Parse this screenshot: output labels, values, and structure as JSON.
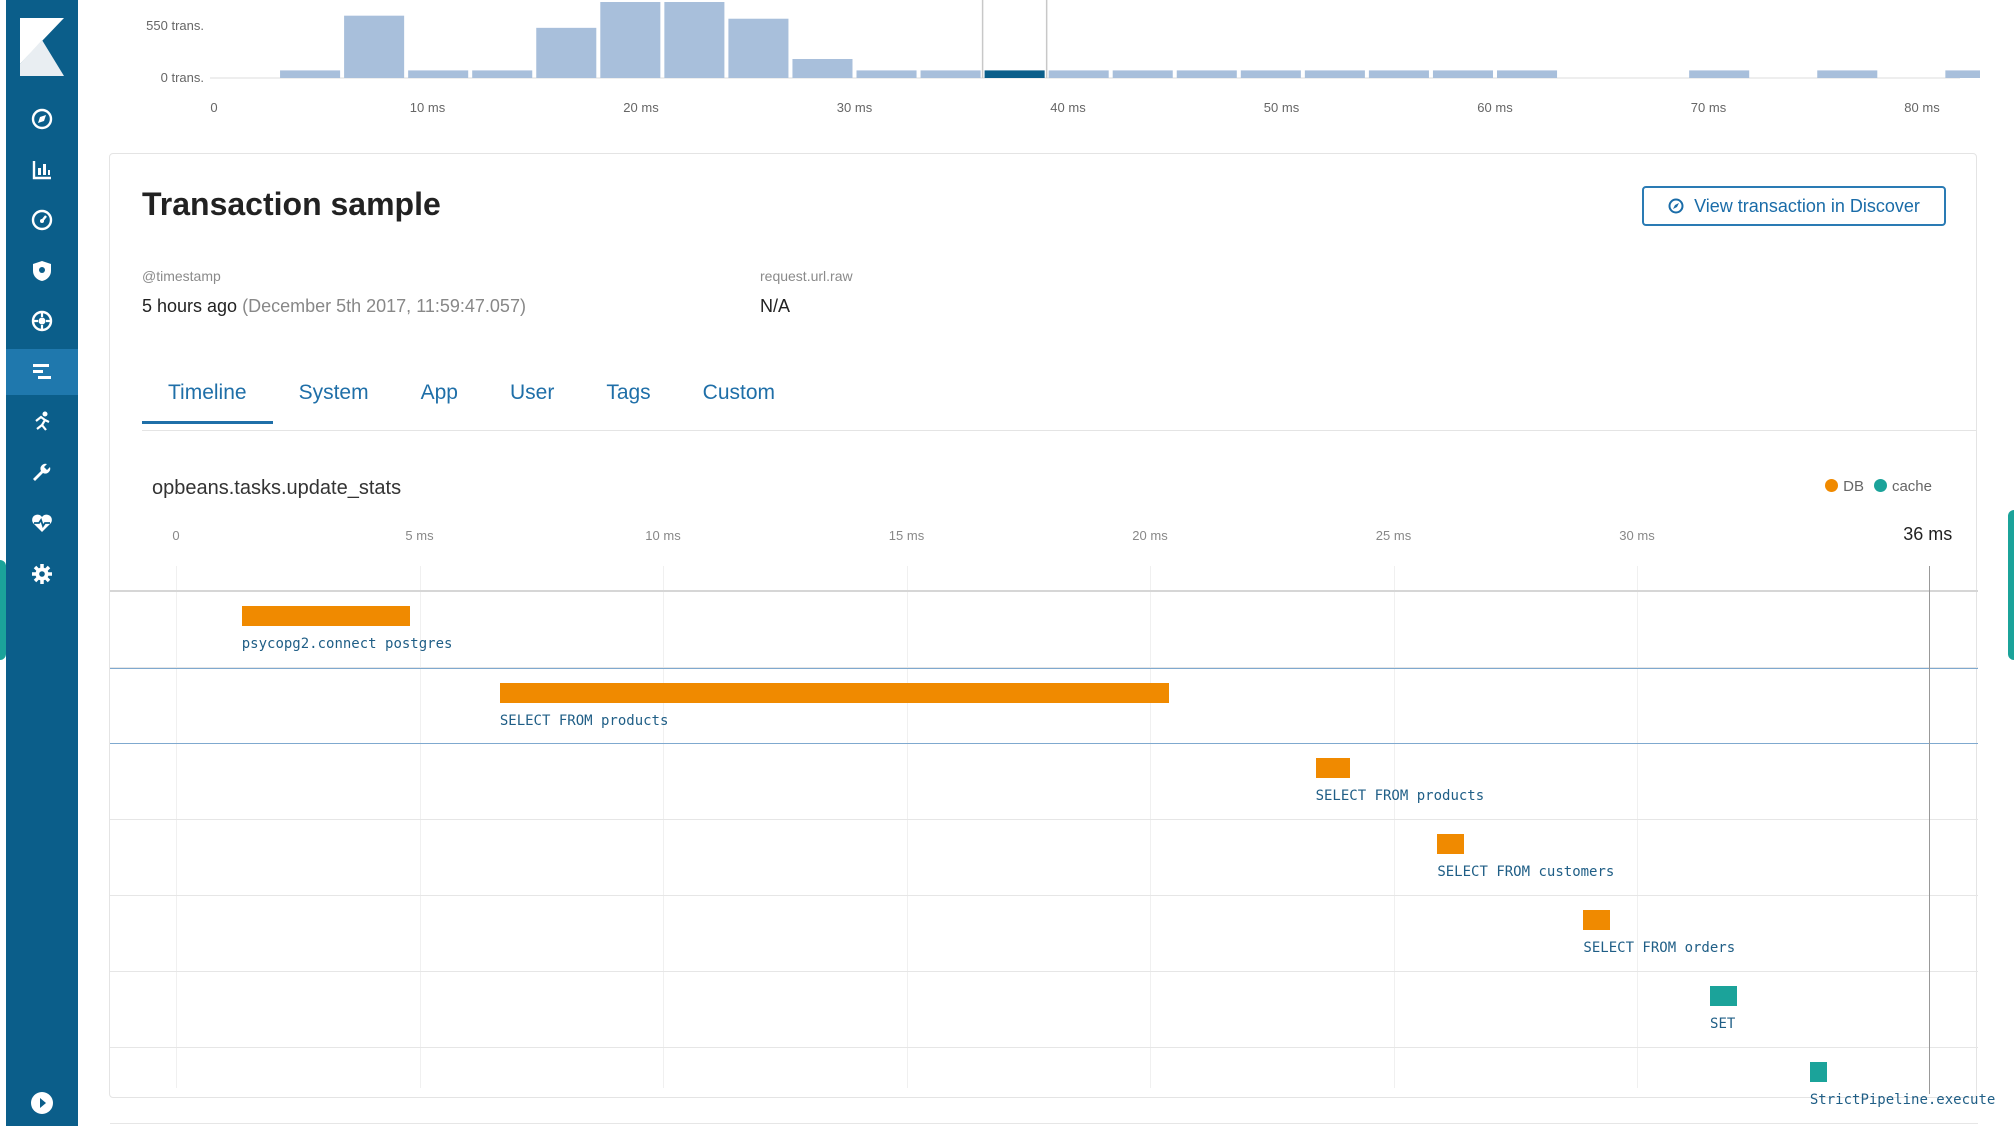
{
  "colors": {
    "sidebar": "#0b5e8a",
    "accent": "#1f6fa8",
    "db": "#f08a00",
    "cache": "#1ba39a",
    "hist_bar": "#a8bfdb",
    "hist_selected": "#0b5e8a"
  },
  "sidebar": {
    "items": [
      {
        "icon": "compass-icon"
      },
      {
        "icon": "bar-chart-icon"
      },
      {
        "icon": "gauge-icon"
      },
      {
        "icon": "shield-icon"
      },
      {
        "icon": "cluster-icon"
      },
      {
        "icon": "apm-icon",
        "active": true
      },
      {
        "icon": "running-icon"
      },
      {
        "icon": "wrench-icon"
      },
      {
        "icon": "heartbeat-icon"
      },
      {
        "icon": "gear-icon"
      }
    ],
    "bottom_icon": "collapse-play-icon"
  },
  "histogram": {
    "y_labels": [
      "550 trans.",
      "0 trans."
    ],
    "x_labels": [
      "0",
      "10 ms",
      "20 ms",
      "30 ms",
      "40 ms",
      "50 ms",
      "60 ms",
      "70 ms",
      "80 ms"
    ],
    "bucket_size_ms": 3,
    "buckets": [
      0,
      10,
      82,
      10,
      10,
      66,
      100,
      100,
      78,
      25,
      10,
      10,
      10,
      10,
      10,
      10,
      10,
      10,
      10,
      10,
      10,
      0,
      0,
      10,
      0,
      10,
      0,
      10
    ],
    "selected_bucket": 12
  },
  "sample": {
    "title": "Transaction sample",
    "discover_button": "View transaction in Discover",
    "timestamp_label": "@timestamp",
    "timestamp_relative": "5 hours ago",
    "timestamp_absolute": "(December 5th 2017, 11:59:47.057)",
    "url_label": "request.url.raw",
    "url_value": "N/A"
  },
  "tabs": [
    {
      "label": "Timeline",
      "active": true
    },
    {
      "label": "System"
    },
    {
      "label": "App"
    },
    {
      "label": "User"
    },
    {
      "label": "Tags"
    },
    {
      "label": "Custom"
    }
  ],
  "timeline": {
    "transaction_name": "opbeans.tasks.update_stats",
    "legend": [
      {
        "label": "DB",
        "color": "#f08a00"
      },
      {
        "label": "cache",
        "color": "#1ba39a"
      }
    ],
    "ticks": [
      "0",
      "5 ms",
      "10 ms",
      "15 ms",
      "20 ms",
      "25 ms",
      "30 ms"
    ],
    "tick_values": [
      0,
      5,
      10,
      15,
      20,
      25,
      30
    ],
    "total_label": "36 ms",
    "total_ms": 36,
    "spans": [
      {
        "name": "psycopg2.connect postgres",
        "type": "db",
        "start": 1.35,
        "duration": 3.45
      },
      {
        "name": "SELECT FROM products",
        "type": "db",
        "start": 6.65,
        "duration": 13.75
      },
      {
        "name": "SELECT FROM products",
        "type": "db",
        "start": 23.4,
        "duration": 0.7
      },
      {
        "name": "SELECT FROM customers",
        "type": "db",
        "start": 25.9,
        "duration": 0.55
      },
      {
        "name": "SELECT FROM orders",
        "type": "db",
        "start": 28.9,
        "duration": 0.55
      },
      {
        "name": "SET",
        "type": "cache",
        "start": 31.5,
        "duration": 0.55
      },
      {
        "name": "StrictPipeline.execute",
        "type": "cache",
        "start": 33.55,
        "duration": 0.35
      }
    ]
  }
}
